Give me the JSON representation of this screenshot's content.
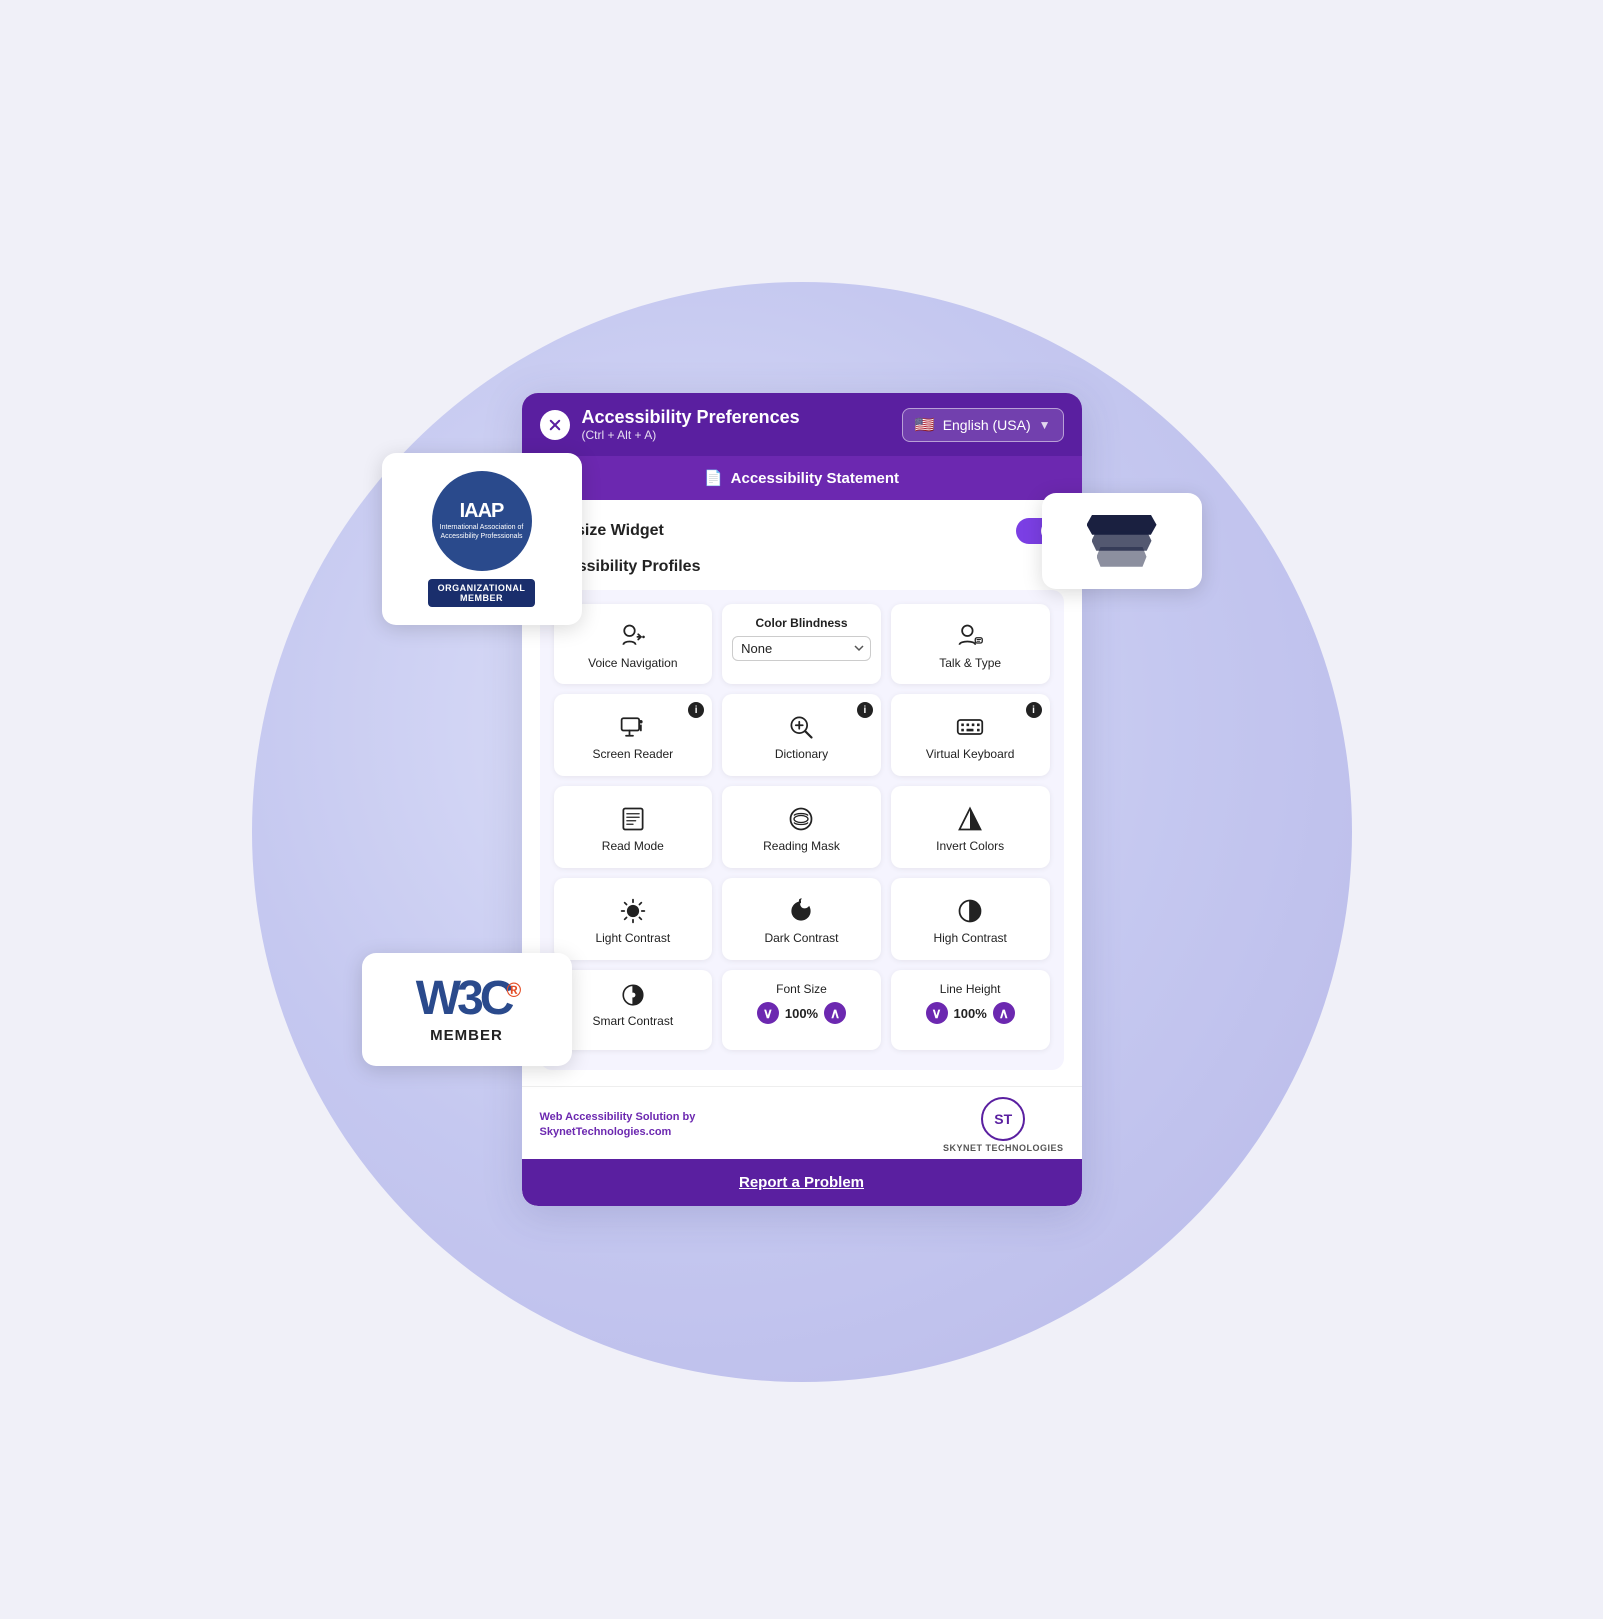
{
  "header": {
    "title": "Accessibility Preferences",
    "shortcut": "(Ctrl + Alt + A)",
    "close_label": "×",
    "language": "English (USA)"
  },
  "accessibility_statement": {
    "label": "Accessibility Statement"
  },
  "oversize_widget": {
    "label": "Oversize Widget",
    "enabled": true
  },
  "accessibility_profiles": {
    "section_title": "Accessibility Profiles"
  },
  "profiles": {
    "voice_navigation": "Voice Navigation",
    "color_blindness_label": "Color Blindness",
    "color_blindness_value": "None",
    "talk_and_type": "Talk & Type"
  },
  "features": [
    {
      "id": "screen-reader",
      "label": "Screen Reader",
      "has_info": true
    },
    {
      "id": "dictionary",
      "label": "Dictionary",
      "has_info": true
    },
    {
      "id": "virtual-keyboard",
      "label": "Virtual Keyboard",
      "has_info": true
    },
    {
      "id": "read-mode",
      "label": "Read Mode",
      "has_info": false
    },
    {
      "id": "reading-mask",
      "label": "Reading Mask",
      "has_info": false
    },
    {
      "id": "invert-colors",
      "label": "Invert Colors",
      "has_info": false
    },
    {
      "id": "light-contrast",
      "label": "Light Contrast",
      "has_info": false
    },
    {
      "id": "dark-contrast",
      "label": "Dark Contrast",
      "has_info": false
    },
    {
      "id": "high-contrast",
      "label": "High Contrast",
      "has_info": false
    }
  ],
  "font_size": {
    "label": "Font Size",
    "value": "100%"
  },
  "line_height": {
    "label": "Line Height",
    "value": "100%"
  },
  "smart_contrast": {
    "label": "Smart Contrast"
  },
  "footer": {
    "attribution": "Web Accessibility Solution by SkynetTechnologies.com",
    "skynet_logo": "ST",
    "skynet_name": "SKYNET TECHNOLOGIES"
  },
  "report_btn": "Report a Problem",
  "iaap": {
    "title": "IAAP",
    "subtitle": "International Association of Accessibility Professionals",
    "badge": "ORGANIZATIONAL\nMEMBER"
  },
  "w3c": {
    "logo": "W3C",
    "registered": "®",
    "member": "MEMBER"
  }
}
